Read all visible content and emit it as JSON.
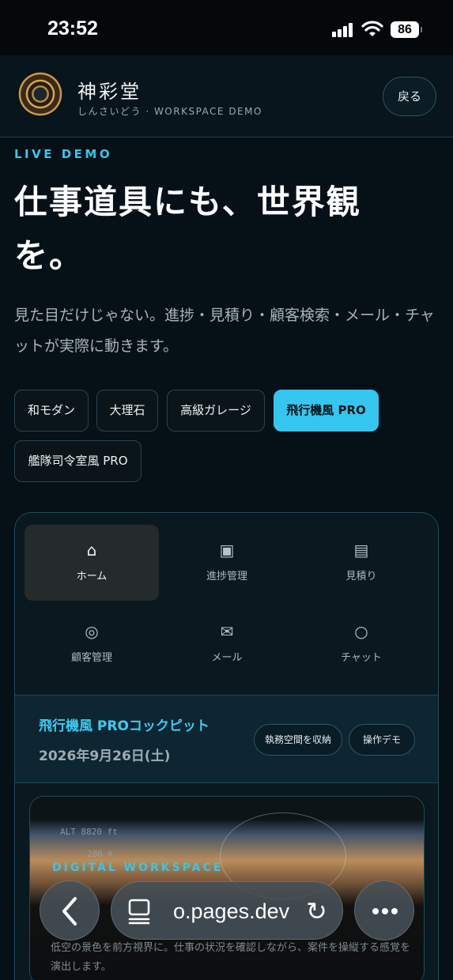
{
  "status_bar": {
    "time": "23:52",
    "battery": "86"
  },
  "header": {
    "brand_name": "神彩堂",
    "brand_sub": "しんさいどう · WORKSPACE DEMO",
    "back_label": "戻る"
  },
  "hero": {
    "eyebrow": "LIVE DEMO",
    "title": "仕事道具にも、世界観を。",
    "description": "見た目だけじゃない。進捗・見積り・顧客検索・メール・チャットが実際に動きます。"
  },
  "themes": [
    {
      "label": "和モダン",
      "active": false
    },
    {
      "label": "大理石",
      "active": false
    },
    {
      "label": "高級ガレージ",
      "active": false
    },
    {
      "label": "飛行機風 PRO",
      "active": true
    },
    {
      "label": "艦隊司令室風 PRO",
      "active": false
    }
  ],
  "nav": [
    {
      "label": "ホーム",
      "icon": "home-icon",
      "glyph": "⌂",
      "active": true
    },
    {
      "label": "進捗管理",
      "icon": "progress-icon",
      "glyph": "▣",
      "active": false
    },
    {
      "label": "見積り",
      "icon": "estimate-icon",
      "glyph": "▤",
      "active": false
    },
    {
      "label": "顧客管理",
      "icon": "customer-icon",
      "glyph": "◎",
      "active": false
    },
    {
      "label": "メール",
      "icon": "mail-icon",
      "glyph": "✉",
      "active": false
    },
    {
      "label": "チャット",
      "icon": "chat-icon",
      "glyph": "○",
      "active": false
    }
  ],
  "workspace": {
    "title": "飛行機風 PROコックピット",
    "date": "2026年9月26日(土)",
    "collapse_label": "執務空間を収納",
    "demo_label": "操作デモ"
  },
  "preview": {
    "hud_altitude": "ALT 8820 ft",
    "hud_speed": "286 k",
    "eyebrow": "DIGITAL WORKSPACE",
    "description": "低空の景色を前方視界に。仕事の状況を確認しながら、案件を操縦する感覚を演出します。"
  },
  "browser": {
    "url": "o.pages.dev"
  },
  "colors": {
    "accent": "#35c6ea",
    "background": "#061017"
  }
}
